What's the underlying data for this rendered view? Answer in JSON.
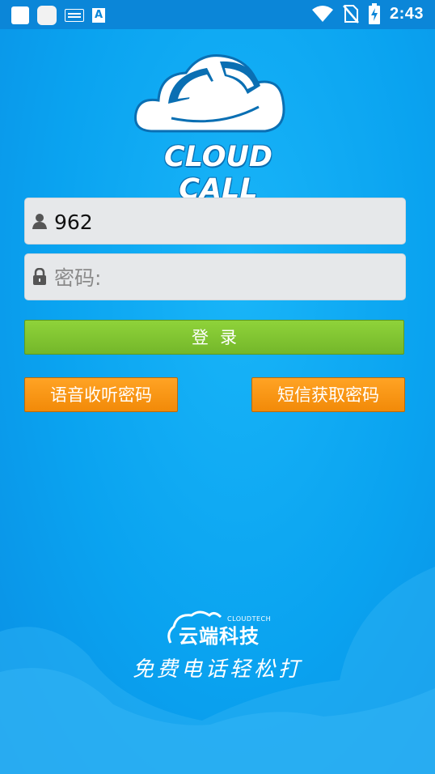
{
  "status_bar": {
    "time": "2:43",
    "icons": [
      "square-icon",
      "rounded-square-icon",
      "keyboard-icon",
      "a-icon",
      "wifi-icon",
      "no-sim-icon",
      "battery-charging-icon"
    ]
  },
  "logo": {
    "text": "CLOUD CALL"
  },
  "form": {
    "username_value": "962",
    "password_placeholder": "密码:"
  },
  "buttons": {
    "login_label": "登录",
    "voice_password_label": "语音收听密码",
    "sms_password_label": "短信获取密码"
  },
  "footer": {
    "company_name": "云端科技",
    "company_sub": "CLOUDTECH",
    "slogan": "免费电话轻松打"
  },
  "colors": {
    "background": "#0aa3f0",
    "login_button": "#7fc22f",
    "orange_button": "#f7920f"
  }
}
